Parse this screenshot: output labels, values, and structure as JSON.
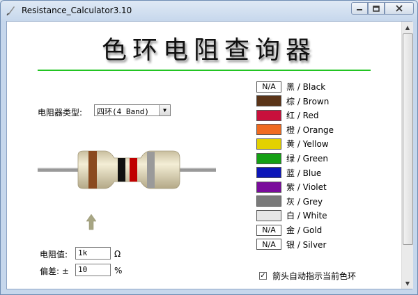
{
  "window": {
    "title": "Resistance_Calculator3.10"
  },
  "heading": "色环电阻查询器",
  "resistor_type": {
    "label": "电阻器类型:",
    "selected": "四环(4 Band)"
  },
  "resistance": {
    "label": "电阻值:",
    "value": "1k",
    "unit": "Ω"
  },
  "tolerance": {
    "label": "偏差: ±",
    "value": "10",
    "unit": "%"
  },
  "current_bands": [
    "#8a4a1f",
    "#111111",
    "#c00000",
    "#9a9a9a"
  ],
  "colors": [
    {
      "swatch_text": "N/A",
      "name": "黑 / Black",
      "hex": "#ffffff"
    },
    {
      "swatch_text": "",
      "name": "棕 / Brown",
      "hex": "#5a3418"
    },
    {
      "swatch_text": "",
      "name": "红 / Red",
      "hex": "#c8103c"
    },
    {
      "swatch_text": "",
      "name": "橙 / Orange",
      "hex": "#f06b20"
    },
    {
      "swatch_text": "",
      "name": "黄 / Yellow",
      "hex": "#e3d100"
    },
    {
      "swatch_text": "",
      "name": "绿 / Green",
      "hex": "#14a014"
    },
    {
      "swatch_text": "",
      "name": "蓝 / Blue",
      "hex": "#0c16b8"
    },
    {
      "swatch_text": "",
      "name": "紫 / Violet",
      "hex": "#7a0c9c"
    },
    {
      "swatch_text": "",
      "name": "灰 / Grey",
      "hex": "#7a7a7a"
    },
    {
      "swatch_text": "",
      "name": "白 / White",
      "hex": "#e6e6e6"
    },
    {
      "swatch_text": "N/A",
      "name": "金 / Gold",
      "hex": "#ffffff"
    },
    {
      "swatch_text": "N/A",
      "name": "银 / Silver",
      "hex": "#ffffff"
    }
  ],
  "auto_arrow": {
    "label": "箭头自动指示当前色环",
    "checked": true,
    "mark": "✓"
  }
}
